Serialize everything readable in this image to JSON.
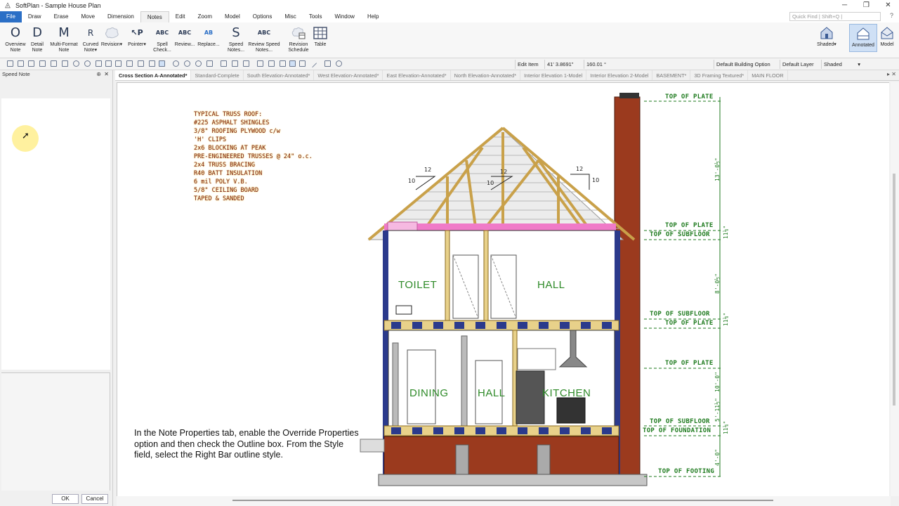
{
  "window": {
    "title": "SoftPlan - Sample House Plan"
  },
  "menu": [
    "File",
    "Draw",
    "Erase",
    "Move",
    "Dimension",
    "Notes",
    "Edit",
    "Zoom",
    "Model",
    "Options",
    "Misc",
    "Tools",
    "Window",
    "Help"
  ],
  "quick_find": {
    "placeholder": "Quick Find | Shift+Q |"
  },
  "ribbon": {
    "buttons": [
      {
        "label": "Overview Note",
        "icon": "O"
      },
      {
        "label": "Detail Note",
        "icon": "D"
      },
      {
        "label": "Multi-Format Note",
        "icon": "M"
      },
      {
        "label": "Curved Note▾",
        "icon": "R"
      },
      {
        "label": "Revision▾",
        "icon": "cloud"
      },
      {
        "label": "Pointer▾",
        "icon": "↖P"
      },
      {
        "label": "Spell Check...",
        "icon": "ABC"
      },
      {
        "label": "Review...",
        "icon": "ABC"
      },
      {
        "label": "Replace...",
        "icon": "AB"
      },
      {
        "label": "Speed Notes...",
        "icon": "S"
      },
      {
        "label": "Review Speed Notes...",
        "icon": "ABC"
      },
      {
        "label": "Revision Schedule",
        "icon": "cloud"
      },
      {
        "label": "Table",
        "icon": "table"
      }
    ],
    "view_buttons": [
      {
        "label": "Shaded▾"
      },
      {
        "label": "Annotated"
      },
      {
        "label": "Model"
      }
    ]
  },
  "toolbar": {
    "edit_item": "Edit Item",
    "length": "41' 3.8691\"",
    "angle": "160.01 °",
    "building_option": "Default Building Option",
    "layer": "Default Layer",
    "render_mode": "Shaded"
  },
  "left_panel": {
    "title": "Speed Note",
    "ok": "OK",
    "cancel": "Cancel"
  },
  "tabs": [
    "Cross Section A-Annotated*",
    "Standard-Complete",
    "South Elevation-Annotated*",
    "West Elevation-Annotated*",
    "East Elevation-Annotated*",
    "North Elevation-Annotated*",
    "Interior Elevation 1-Model",
    "Interior Elevation 2-Model",
    "BASEMENT*",
    "3D Framing Textured*",
    "MAIN FLOOR"
  ],
  "drawing": {
    "roof_notes": [
      "TYPICAL TRUSS ROOF:",
      "#225 ASPHALT SHINGLES",
      "3/8\" ROOFING PLYWOOD c/w",
      "'H' CLIPS",
      "2x6 BLOCKING AT PEAK",
      "PRE-ENGINEERED TRUSSES @ 24\" o.c.",
      "2x4 TRUSS BRACING",
      "R40 BATT INSULATION",
      "6 mil POLY V.B.",
      "5/8\" CEILING BOARD",
      "TAPED & SANDED"
    ],
    "rooms": [
      "TOILET",
      "HALL",
      "DINING",
      "HALL",
      "KITCHEN"
    ],
    "pitch": [
      "12",
      "10",
      "12",
      "10",
      "12",
      "10"
    ],
    "levels": [
      "TOP OF PLATE",
      "TOP OF PLATE",
      "TOP OF SUBFLOOR",
      "TOP OF SUBFLOOR",
      "TOP OF PLATE",
      "TOP OF PLATE",
      "TOP OF SUBFLOOR",
      "TOP OF FOUNDATION",
      "TOP OF FOOTING"
    ],
    "dims": [
      "13'-0½\"",
      "11⅛\"",
      "8'-0½\"",
      "11⅛\"",
      "10'-0\"",
      "5'-11½\"",
      "11⅛\"",
      "4'-0\""
    ]
  },
  "caption": "In the Note Properties tab, enable the Override Properties option and then check the Outline box. From the Style field, select the Right Bar outline style.",
  "colors": {
    "accent": "#2b6fc6",
    "room_text": "#2e8a28",
    "note_text": "#7b1c1c",
    "note_glow": "#f6df6e",
    "brick": "#9b3a1e",
    "floor_joist": "#e8d18a",
    "ceiling_insulation": "#f07ac8",
    "framing": "#c9a14a"
  }
}
